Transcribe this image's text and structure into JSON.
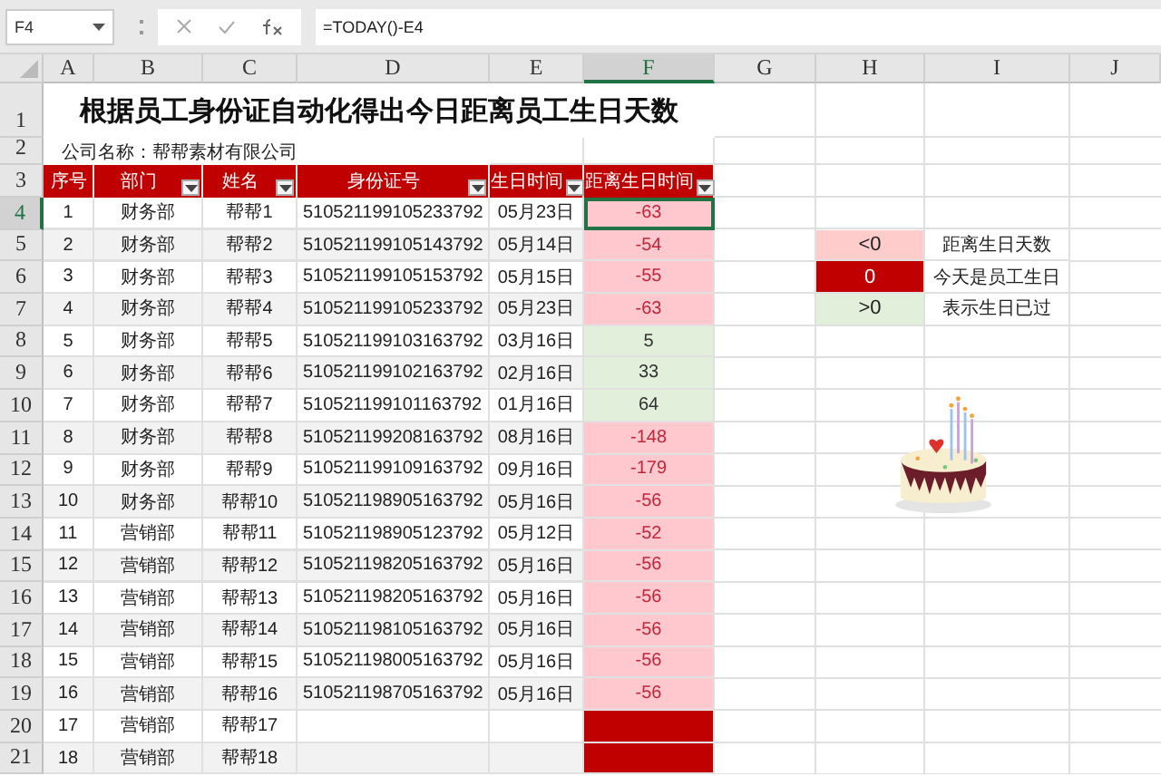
{
  "formula_bar": {
    "name_box": "F4",
    "formula": "=TODAY()-E4"
  },
  "columns": [
    {
      "label": "A",
      "selected": false
    },
    {
      "label": "B",
      "selected": false
    },
    {
      "label": "C",
      "selected": false
    },
    {
      "label": "D",
      "selected": false
    },
    {
      "label": "E",
      "selected": false
    },
    {
      "label": "F",
      "selected": true
    },
    {
      "label": "G",
      "selected": false
    },
    {
      "label": "H",
      "selected": false
    },
    {
      "label": "I",
      "selected": false
    },
    {
      "label": "J",
      "selected": false
    }
  ],
  "row_numbers": [
    "1",
    "2",
    "3",
    "4",
    "5",
    "6",
    "7",
    "8",
    "9",
    "10",
    "11",
    "12",
    "13",
    "14",
    "15",
    "16",
    "17",
    "18",
    "19",
    "20",
    "21"
  ],
  "title": "根据员工身份证自动化得出今日距离员工生日天数",
  "company": "公司名称：帮帮素材有限公司",
  "headers": [
    {
      "label": "序号",
      "filter": false
    },
    {
      "label": "部门",
      "filter": true
    },
    {
      "label": "姓名",
      "filter": true
    },
    {
      "label": "身份证号",
      "filter": true
    },
    {
      "label": "生日时间",
      "filter": true
    },
    {
      "label": "距离生日时间",
      "filter": true
    }
  ],
  "rows": [
    {
      "no": "1",
      "dept": "财务部",
      "name": "帮帮1",
      "id": "510521199105233792",
      "birthday": "05月23日",
      "days": "-63",
      "kind": "negative",
      "selected": true
    },
    {
      "no": "2",
      "dept": "财务部",
      "name": "帮帮2",
      "id": "510521199105143792",
      "birthday": "05月14日",
      "days": "-54",
      "kind": "negative",
      "selected": false
    },
    {
      "no": "3",
      "dept": "财务部",
      "name": "帮帮3",
      "id": "510521199105153792",
      "birthday": "05月15日",
      "days": "-55",
      "kind": "negative",
      "selected": false
    },
    {
      "no": "4",
      "dept": "财务部",
      "name": "帮帮4",
      "id": "510521199105233792",
      "birthday": "05月23日",
      "days": "-63",
      "kind": "negative",
      "selected": false
    },
    {
      "no": "5",
      "dept": "财务部",
      "name": "帮帮5",
      "id": "510521199103163792",
      "birthday": "03月16日",
      "days": "5",
      "kind": "positive",
      "selected": false
    },
    {
      "no": "6",
      "dept": "财务部",
      "name": "帮帮6",
      "id": "510521199102163792",
      "birthday": "02月16日",
      "days": "33",
      "kind": "positive",
      "selected": false
    },
    {
      "no": "7",
      "dept": "财务部",
      "name": "帮帮7",
      "id": "510521199101163792",
      "birthday": "01月16日",
      "days": "64",
      "kind": "positive",
      "selected": false
    },
    {
      "no": "8",
      "dept": "财务部",
      "name": "帮帮8",
      "id": "510521199208163792",
      "birthday": "08月16日",
      "days": "-148",
      "kind": "negative",
      "selected": false
    },
    {
      "no": "9",
      "dept": "财务部",
      "name": "帮帮9",
      "id": "510521199109163792",
      "birthday": "09月16日",
      "days": "-179",
      "kind": "negative",
      "selected": false
    },
    {
      "no": "10",
      "dept": "财务部",
      "name": "帮帮10",
      "id": "510521198905163792",
      "birthday": "05月16日",
      "days": "-56",
      "kind": "negative",
      "selected": false
    },
    {
      "no": "11",
      "dept": "营销部",
      "name": "帮帮11",
      "id": "510521198905123792",
      "birthday": "05月12日",
      "days": "-52",
      "kind": "negative",
      "selected": false
    },
    {
      "no": "12",
      "dept": "营销部",
      "name": "帮帮12",
      "id": "510521198205163792",
      "birthday": "05月16日",
      "days": "-56",
      "kind": "negative",
      "selected": false
    },
    {
      "no": "13",
      "dept": "营销部",
      "name": "帮帮13",
      "id": "510521198205163792",
      "birthday": "05月16日",
      "days": "-56",
      "kind": "negative",
      "selected": false
    },
    {
      "no": "14",
      "dept": "营销部",
      "name": "帮帮14",
      "id": "510521198105163792",
      "birthday": "05月16日",
      "days": "-56",
      "kind": "negative",
      "selected": false
    },
    {
      "no": "15",
      "dept": "营销部",
      "name": "帮帮15",
      "id": "510521198005163792",
      "birthday": "05月16日",
      "days": "-56",
      "kind": "negative",
      "selected": false
    },
    {
      "no": "16",
      "dept": "营销部",
      "name": "帮帮16",
      "id": "510521198705163792",
      "birthday": "05月16日",
      "days": "-56",
      "kind": "negative",
      "selected": false
    },
    {
      "no": "17",
      "dept": "营销部",
      "name": "帮帮17",
      "kind": "zero",
      "selected": false
    },
    {
      "no": "18",
      "dept": "营销部",
      "name": "帮帮18",
      "kind": "zero",
      "selected": false
    }
  ],
  "legend": [
    {
      "value": "<0",
      "kind": "negative",
      "meaning": "距离生日天数"
    },
    {
      "value": "0",
      "kind": "zero",
      "meaning": "今天是员工生日"
    },
    {
      "value": ">0",
      "kind": "positive",
      "meaning": "表示生日已过"
    }
  ]
}
